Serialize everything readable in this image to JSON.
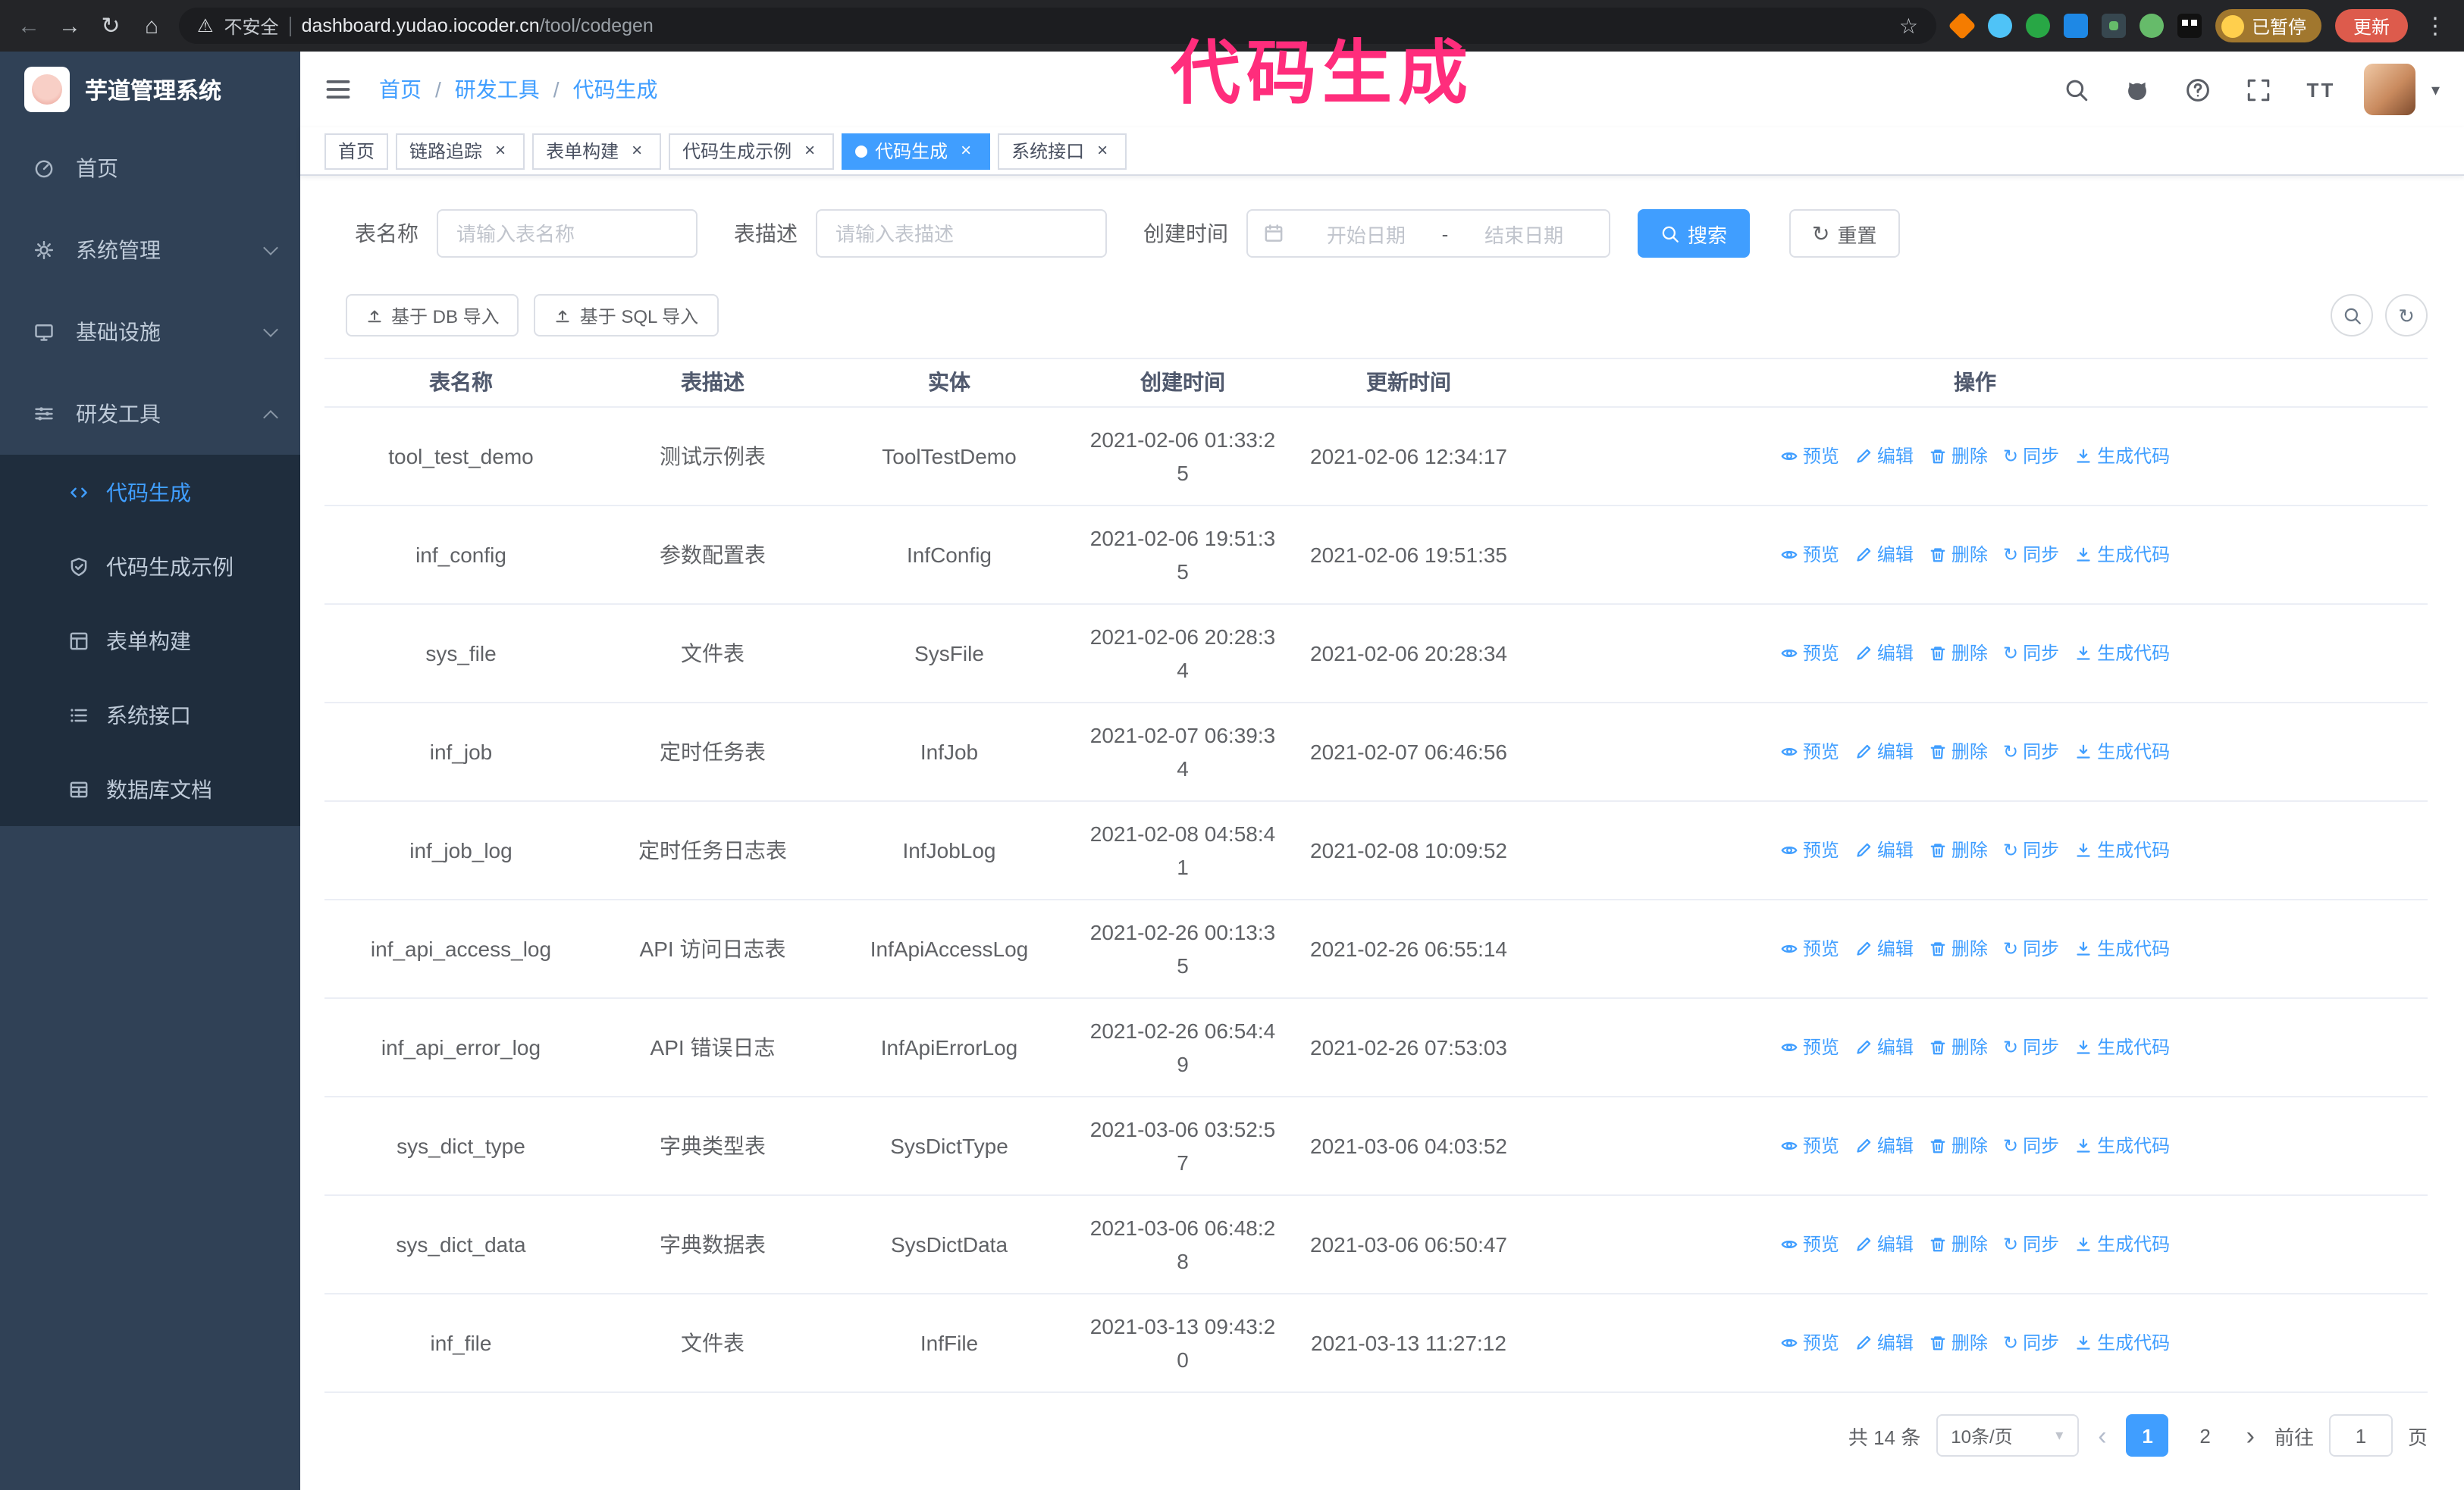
{
  "annotation": {
    "text": "代码生成"
  },
  "browser": {
    "insecure_label": "不安全",
    "url_host": "dashboard.yudao.iocoder.cn",
    "url_path": "/tool/codegen",
    "paused_badge": "已暂停",
    "update_button": "更新"
  },
  "icons": {
    "back": "←",
    "forward": "→",
    "reload": "↻",
    "home": "⌂",
    "warning": "⚠",
    "star": "☆",
    "kebab": "⋮",
    "caret_down": "▾",
    "close": "×",
    "refresh": "↻",
    "prev": "‹",
    "next": "›",
    "font_size": "T T"
  },
  "sidebar": {
    "app_title": "芋道管理系统",
    "menu": [
      {
        "label": "首页"
      },
      {
        "label": "系统管理"
      },
      {
        "label": "基础设施"
      },
      {
        "label": "研发工具"
      }
    ],
    "submenu": [
      {
        "label": "代码生成"
      },
      {
        "label": "代码生成示例"
      },
      {
        "label": "表单构建"
      },
      {
        "label": "系统接口"
      },
      {
        "label": "数据库文档"
      }
    ]
  },
  "header": {
    "breadcrumb": [
      "首页",
      "研发工具",
      "代码生成"
    ],
    "separator": "/"
  },
  "tabs": [
    {
      "label": "首页"
    },
    {
      "label": "链路追踪"
    },
    {
      "label": "表单构建"
    },
    {
      "label": "代码生成示例"
    },
    {
      "label": "代码生成"
    },
    {
      "label": "系统接口"
    }
  ],
  "filters": {
    "name_label": "表名称",
    "name_placeholder": "请输入表名称",
    "desc_label": "表描述",
    "desc_placeholder": "请输入表描述",
    "time_label": "创建时间",
    "date_start": "开始日期",
    "date_separator": "-",
    "date_end": "结束日期",
    "search_button": "搜索",
    "reset_button": "重置"
  },
  "toolbar": {
    "import_db": "基于 DB 导入",
    "import_sql": "基于 SQL 导入"
  },
  "table": {
    "columns": [
      "表名称",
      "表描述",
      "实体",
      "创建时间",
      "更新时间",
      "操作"
    ],
    "ops": [
      {
        "label": "预览"
      },
      {
        "label": "编辑"
      },
      {
        "label": "删除"
      },
      {
        "label": "同步"
      },
      {
        "label": "生成代码"
      }
    ],
    "rows": [
      {
        "name": "tool_test_demo",
        "desc": "测试示例表",
        "entity": "ToolTestDemo",
        "created": "2021-02-06 01:33:25",
        "updated": "2021-02-06 12:34:17"
      },
      {
        "name": "inf_config",
        "desc": "参数配置表",
        "entity": "InfConfig",
        "created": "2021-02-06 19:51:35",
        "updated": "2021-02-06 19:51:35"
      },
      {
        "name": "sys_file",
        "desc": "文件表",
        "entity": "SysFile",
        "created": "2021-02-06 20:28:34",
        "updated": "2021-02-06 20:28:34"
      },
      {
        "name": "inf_job",
        "desc": "定时任务表",
        "entity": "InfJob",
        "created": "2021-02-07 06:39:34",
        "updated": "2021-02-07 06:46:56"
      },
      {
        "name": "inf_job_log",
        "desc": "定时任务日志表",
        "entity": "InfJobLog",
        "created": "2021-02-08 04:58:41",
        "updated": "2021-02-08 10:09:52"
      },
      {
        "name": "inf_api_access_log",
        "desc": "API 访问日志表",
        "entity": "InfApiAccessLog",
        "created": "2021-02-26 00:13:35",
        "updated": "2021-02-26 06:55:14"
      },
      {
        "name": "inf_api_error_log",
        "desc": "API 错误日志",
        "entity": "InfApiErrorLog",
        "created": "2021-02-26 06:54:49",
        "updated": "2021-02-26 07:53:03"
      },
      {
        "name": "sys_dict_type",
        "desc": "字典类型表",
        "entity": "SysDictType",
        "created": "2021-03-06 03:52:57",
        "updated": "2021-03-06 04:03:52"
      },
      {
        "name": "sys_dict_data",
        "desc": "字典数据表",
        "entity": "SysDictData",
        "created": "2021-03-06 06:48:28",
        "updated": "2021-03-06 06:50:47"
      },
      {
        "name": "inf_file",
        "desc": "文件表",
        "entity": "InfFile",
        "created": "2021-03-13 09:43:20",
        "updated": "2021-03-13 11:27:12"
      }
    ]
  },
  "pagination": {
    "total": "共 14 条",
    "page_size": "10条/页",
    "pages": [
      "1",
      "2"
    ],
    "goto_label": "前往",
    "goto_value": "1",
    "goto_suffix": "页"
  },
  "colors": {
    "primary": "#409eff",
    "annotation_pink": "#ff2d7c",
    "sidebar_bg": "#304156",
    "submenu_bg": "#1f2d3d"
  }
}
